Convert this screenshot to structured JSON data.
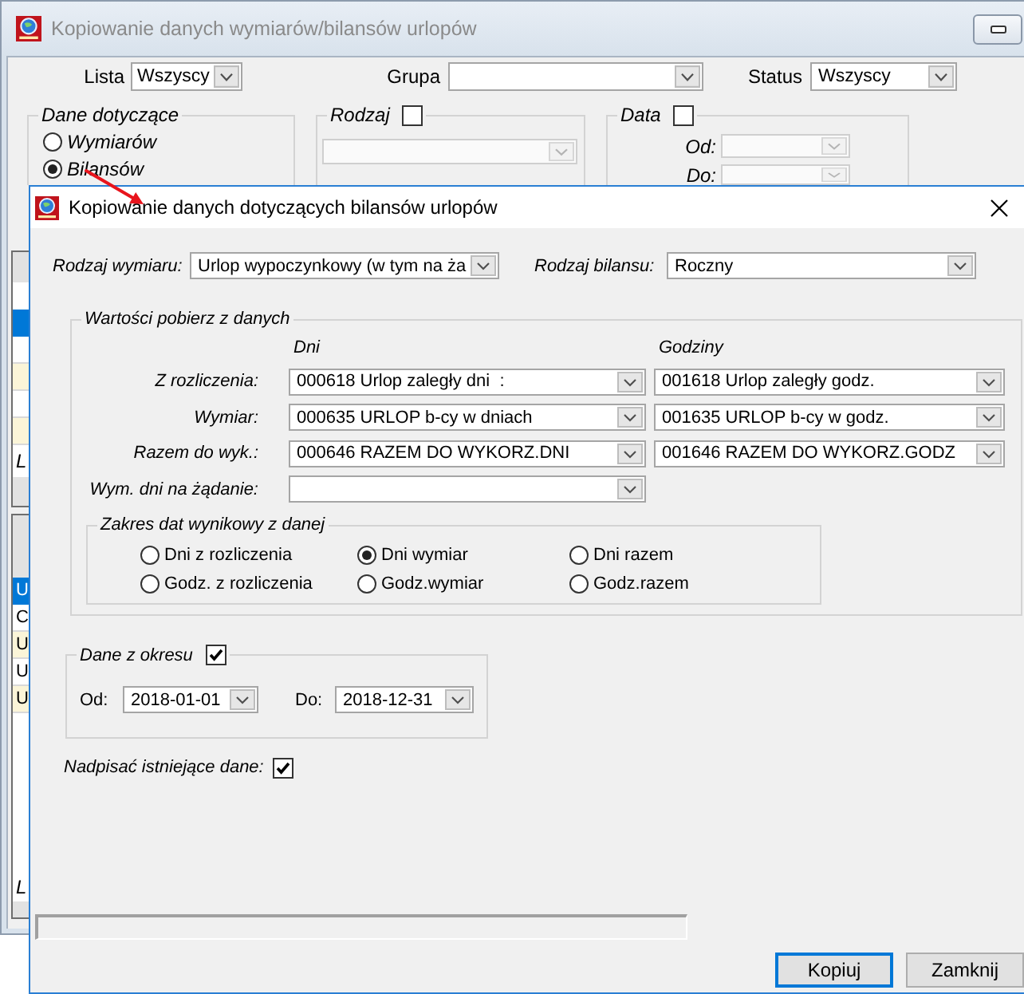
{
  "background_window": {
    "title": "Kopiowanie danych wymiarów/bilansów urlopów",
    "filters": [
      {
        "label": "Lista",
        "value": "Wszyscy"
      },
      {
        "label": "Grupa"
      },
      {
        "label": "Status",
        "value": "Wszyscy"
      }
    ],
    "dane_dotyczace": {
      "title": "Dane dotyczące",
      "options": [
        {
          "label": "Wymiarów",
          "selected": false
        },
        {
          "label": "Bilansów",
          "selected": true
        }
      ]
    },
    "rodzaj": {
      "title": "Rodzaj",
      "checked": false
    },
    "data": {
      "title": "Data",
      "checked": false,
      "fields": [
        {
          "label": "Od:"
        },
        {
          "label": "Do:"
        }
      ]
    },
    "side_lists": [
      {
        "rows": [
          {
            "selected": true
          },
          {
            "selected": false
          },
          {
            "selected": false
          },
          {
            "selected": false
          },
          {
            "selected": false
          }
        ],
        "caption": "L"
      },
      {
        "rows": [
          {
            "text": "U",
            "selected": true
          },
          {
            "text": "C",
            "selected": false
          },
          {
            "text": "U",
            "selected": false
          },
          {
            "text": "U",
            "selected": false
          },
          {
            "text": "U",
            "selected": false
          }
        ],
        "caption": "L"
      }
    ]
  },
  "dialog": {
    "title": "Kopiowanie danych dotyczących bilansów urlopów",
    "header_fields": [
      {
        "label": "Rodzaj wymiaru:",
        "value": "Urlop wypoczynkowy (w tym na ża"
      },
      {
        "label": "Rodzaj bilansu:",
        "value": "Roczny"
      }
    ],
    "wartosci": {
      "title": "Wartości pobierz z danych",
      "columns": [
        "Dni",
        "Godziny"
      ],
      "rows": [
        {
          "label": "Z rozliczenia:",
          "fields": [
            {
              "value": "000618 Urlop zaległy dni  :"
            },
            {
              "value": "001618 Urlop zaległy godz."
            }
          ]
        },
        {
          "label": "Wymiar:",
          "fields": [
            {
              "value": "000635 URLOP b-cy w dniach"
            },
            {
              "value": "001635 URLOP b-cy w godz."
            }
          ]
        },
        {
          "label": "Razem do wyk.:",
          "fields": [
            {
              "value": "000646 RAZEM DO WYKORZ.DNI"
            },
            {
              "value": "001646 RAZEM DO WYKORZ.GODZ"
            }
          ]
        },
        {
          "label": "Wym. dni na żądanie:"
        }
      ]
    },
    "zakres": {
      "title": "Zakres dat wynikowy z danej",
      "options": [
        {
          "label": "Dni z rozliczenia",
          "selected": false
        },
        {
          "label": "Dni wymiar",
          "selected": true
        },
        {
          "label": "Dni razem",
          "selected": false
        },
        {
          "label": "Godz. z rozliczenia",
          "selected": false
        },
        {
          "label": "Godz.wymiar",
          "selected": false
        },
        {
          "label": "Godz.razem",
          "selected": false
        }
      ]
    },
    "okres": {
      "title": "Dane z okresu",
      "checked": true,
      "fields": [
        {
          "label": "Od:",
          "value": "2018-01-01"
        },
        {
          "label": "Do:",
          "value": "2018-12-31"
        }
      ]
    },
    "overwrite": {
      "label": "Nadpisać istniejące dane:",
      "checked": true
    },
    "buttons": [
      {
        "label": "Kopiuj",
        "default": true
      },
      {
        "label": "Zamknij",
        "default": false
      }
    ]
  }
}
